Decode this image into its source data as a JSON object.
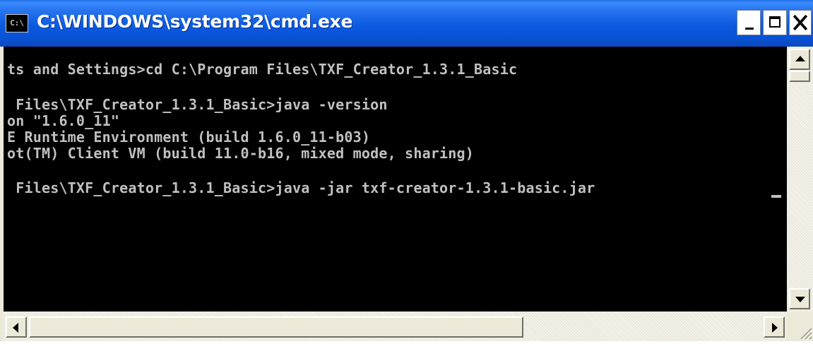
{
  "window": {
    "title": "C:\\WINDOWS\\system32\\cmd.exe",
    "icon_text": "C:\\",
    "buttons": {
      "minimize": "minimize",
      "maximize": "maximize",
      "close": "close"
    }
  },
  "console": {
    "background": "#000000",
    "foreground": "#c0c0c0",
    "lines": [
      "ts and Settings>cd C:\\Program Files\\TXF_Creator_1.3.1_Basic",
      "",
      " Files\\TXF_Creator_1.3.1_Basic>java -version",
      "on \"1.6.0_11\"",
      "E Runtime Environment (build 1.6.0_11-b03)",
      "ot(TM) Client VM (build 11.0-b16, mixed mode, sharing)",
      "",
      " Files\\TXF_Creator_1.3.1_Basic>java -jar txf-creator-1.3.1-basic.jar"
    ]
  },
  "colors": {
    "titlebar": "#0852d6",
    "chrome": "#ece9d8",
    "close_button": "#ffffff"
  }
}
